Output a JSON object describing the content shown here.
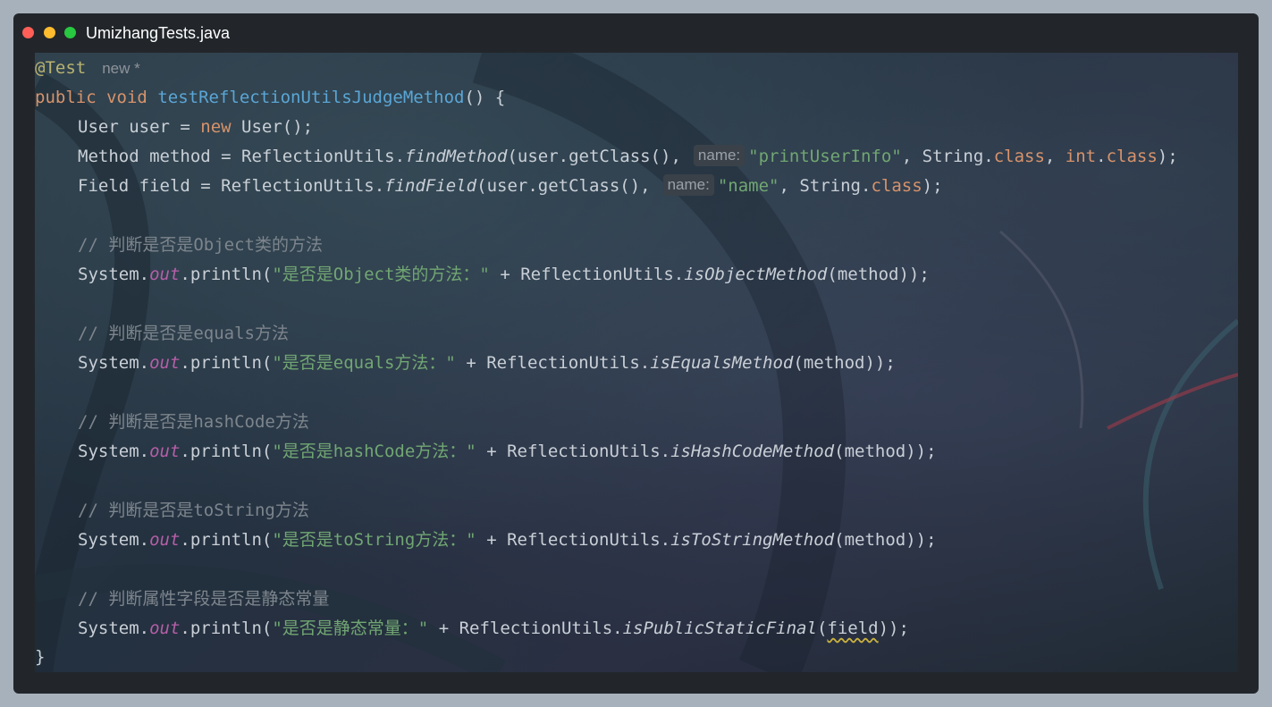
{
  "window": {
    "title": "UmizhangTests.java"
  },
  "editor": {
    "annotation": "@Test",
    "new_hint": "new *",
    "sig": {
      "public": "public",
      "void": "void",
      "method_name": "testReflectionUtilsJudgeMethod",
      "rest": "() {"
    },
    "line_user": {
      "a": "User user = ",
      "new": "new",
      "b": " User();"
    },
    "line_method": {
      "a": "Method method = ReflectionUtils.",
      "fn": "findMethod",
      "b": "(user.getClass(),",
      "hint": "name:",
      "str": "\"printUserInfo\"",
      "c": ", String.",
      "class1": "class",
      "d": ", ",
      "int": "int",
      "e": ".",
      "class2": "class",
      "f": ");"
    },
    "line_field": {
      "a": "Field field = ReflectionUtils.",
      "fn": "findField",
      "b": "(user.getClass(),",
      "hint": "name:",
      "str": "\"name\"",
      "c": ", String.",
      "class1": "class",
      "d": ");"
    },
    "sys": "System.",
    "out": "out",
    "println": ".println(",
    "plus": " + ReflectionUtils.",
    "c1": "// 判断是否是Object类的方法",
    "s1": "\"是否是Object类的方法：\"",
    "m1": "isObjectMethod",
    "a1": "(method));",
    "c2": "// 判断是否是equals方法",
    "s2": "\"是否是equals方法：\"",
    "m2": "isEqualsMethod",
    "a2": "(method));",
    "c3": "// 判断是否是hashCode方法",
    "s3": "\"是否是hashCode方法：\"",
    "m3": "isHashCodeMethod",
    "a3": "(method));",
    "c4": "// 判断是否是toString方法",
    "s4": "\"是否是toString方法：\"",
    "m4": "isToStringMethod",
    "a4": "(method));",
    "c5": "// 判断属性字段是否是静态常量",
    "s5": "\"是否是静态常量：\"",
    "m5": "isPublicStaticFinal",
    "a5_open": "(",
    "a5_arg": "field",
    "a5_close": "));",
    "closing": "}"
  }
}
